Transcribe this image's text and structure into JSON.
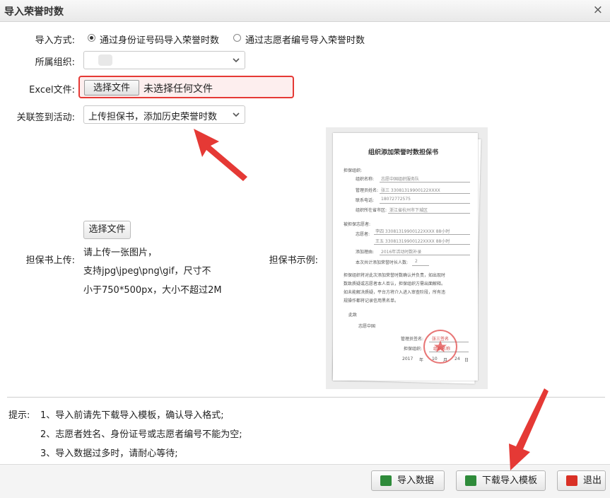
{
  "window": {
    "title": "导入荣誉时数"
  },
  "form": {
    "import_mode_label": "导入方式:",
    "import_mode_options": [
      "通过身份证号码导入荣誉时数",
      "通过志愿者编号导入荣誉时数"
    ],
    "org_label": "所属组织:",
    "org_value": "",
    "excel_label": "Excel文件:",
    "excel_button": "选择文件",
    "excel_status": "未选择任何文件",
    "activity_label": "关联签到活动:",
    "activity_value": "上传担保书，添加历史荣誉时数",
    "guarantee_label": "担保书上传:",
    "guarantee_button": "选择文件",
    "guarantee_hints": [
      "请上传一张图片，",
      "支持jpg\\jpeg\\png\\gif，尺寸不",
      "小于750*500px，大小不超过2M"
    ],
    "sample_label": "担保书示例:"
  },
  "sample_doc": {
    "title": "组织添加荣誉时数担保书",
    "guarantor_header": "担保组织:",
    "org_name_label": "组织名称:",
    "org_name_value": "志愿中国组织服务队",
    "admin_label": "管理员姓名:",
    "admin_value": "张三 33081319900122XXXX",
    "phone_label": "联系电话:",
    "phone_value": "18072772575",
    "region_label": "组织所在省市区:",
    "region_value": "浙江省杭州市下城区",
    "guaranteed_header": "被担保志愿者:",
    "volunteer_label": "志愿者:",
    "volunteer_rows": [
      "李四 33081319900122XXXX  88小时",
      "王五 33081319900122XXXX  88小时"
    ],
    "reason_label": "添加理由:",
    "reason_value": "2016年活动时数补录",
    "count_label": "本次共计添加荣誉时长人数:",
    "count_value": "2",
    "body_text": [
      "担保组织将对此次添加荣誉时数确认并负责，如出现时",
      "数致质疑或志愿者本人否认，担保组织方需出面解释。",
      "如未能解决质疑，平台方将介入进入审查阶段，所有违",
      "规操作都将记录信用黑名单。"
    ],
    "closing": "此致",
    "closing_to": "志愿中国",
    "sign_admin": "管理员签名:",
    "sign_admin_value": "张三签名",
    "sign_org": "担保组织:",
    "sign_org_value": "组织名称",
    "date_year": "2017",
    "date_year_label": "年",
    "date_month": "10",
    "date_month_label": "月",
    "date_day": "24",
    "date_day_label": "日"
  },
  "tips": {
    "prefix": "提示:",
    "items": [
      "1、导入前请先下载导入模板，确认导入格式;",
      "2、志愿者姓名、身份证号或志愿者编号不能为空;",
      "3、导入数据过多时，请耐心等待;"
    ]
  },
  "footer": {
    "import_label": "导入数据",
    "download_label": "下载导入模板",
    "exit_label": "退出"
  },
  "colors": {
    "highlight": "#e53935",
    "excel_icon": "#2e8b3a",
    "exit_icon": "#d93025"
  }
}
